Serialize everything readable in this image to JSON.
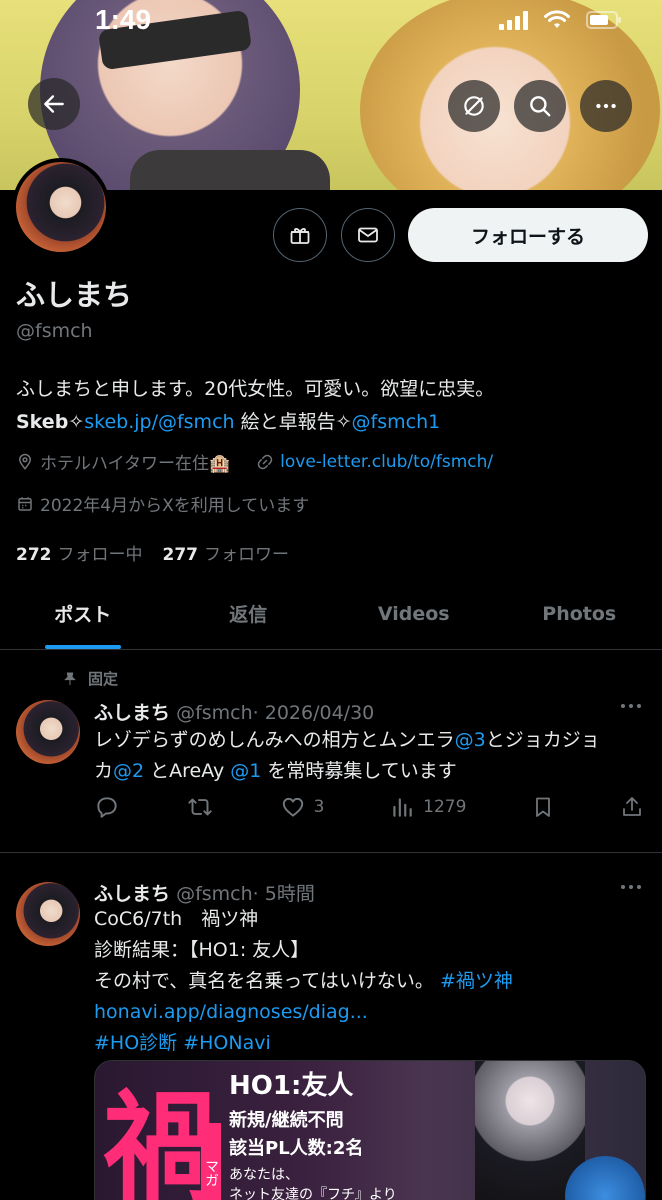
{
  "status_bar": {
    "time": "1:49"
  },
  "profile": {
    "name": "ふしまち",
    "handle": "@fsmch",
    "bio_line1": "ふしまちと申します。20代女性。可愛い。欲望に忠実。",
    "bio_line2_prefix": "Skeb✧",
    "bio_line2_link": "skeb.jp/@fsmch",
    "bio_line2_middle": " 絵と卓報告✧",
    "bio_line2_mention": "@fsmch1",
    "location": "ホテルハイタワー在住🏨",
    "website": "love-letter.club/to/fsmch/",
    "joined": "2022年4月からXを利用しています",
    "following_count": "272",
    "following_label": "フォロー中",
    "followers_count": "277",
    "followers_label": "フォロワー",
    "follow_button": "フォローする"
  },
  "tabs": [
    {
      "label": "ポスト",
      "active": true
    },
    {
      "label": "返信",
      "active": false
    },
    {
      "label": "Videos",
      "active": false
    },
    {
      "label": "Photos",
      "active": false
    }
  ],
  "posts": [
    {
      "pinned_label": "固定",
      "name": "ふしまち",
      "handle": "@fsmch",
      "time": "· 2026/04/30",
      "text_parts": {
        "l1_a": "レゾデらずのめしんみへの相方とムンエラ",
        "l1_m": "@3",
        "l1_b": "とジョカジョ",
        "l2_a": "カ",
        "l2_m1": "@2",
        "l2_b": " とAreAy ",
        "l2_m2": "@1",
        "l2_c": " を常時募集しています"
      },
      "reply_count": "",
      "repost_count": "",
      "like_count": "3",
      "view_count": "1279"
    },
    {
      "name": "ふしまち",
      "handle": "@fsmch",
      "time": "· 5時間",
      "line1": "CoC6/7th　禍ツ神",
      "line2": "診断結果：【HO1: 友人】",
      "line3_a": "その村で、真名を名乗ってはいけない。 ",
      "line3_tag": "#禍ツ神",
      "line4": "honavi.app/diagnoses/diag...",
      "line5_tag1": "#HO診断",
      "line5_tag2": "#HONavi",
      "media": {
        "kanji": "禍",
        "side_tag": "マガ",
        "title": "HO1:友人",
        "l2": "新規/継続不問",
        "l3": "該当PL人数:2名",
        "l4": "あなたは、",
        "l5": "ネット友達の『フチ』より"
      }
    }
  ],
  "colors": {
    "accent": "#1d9bf0",
    "muted": "#71767b",
    "text": "#e7e9ea",
    "bg": "#000000"
  }
}
